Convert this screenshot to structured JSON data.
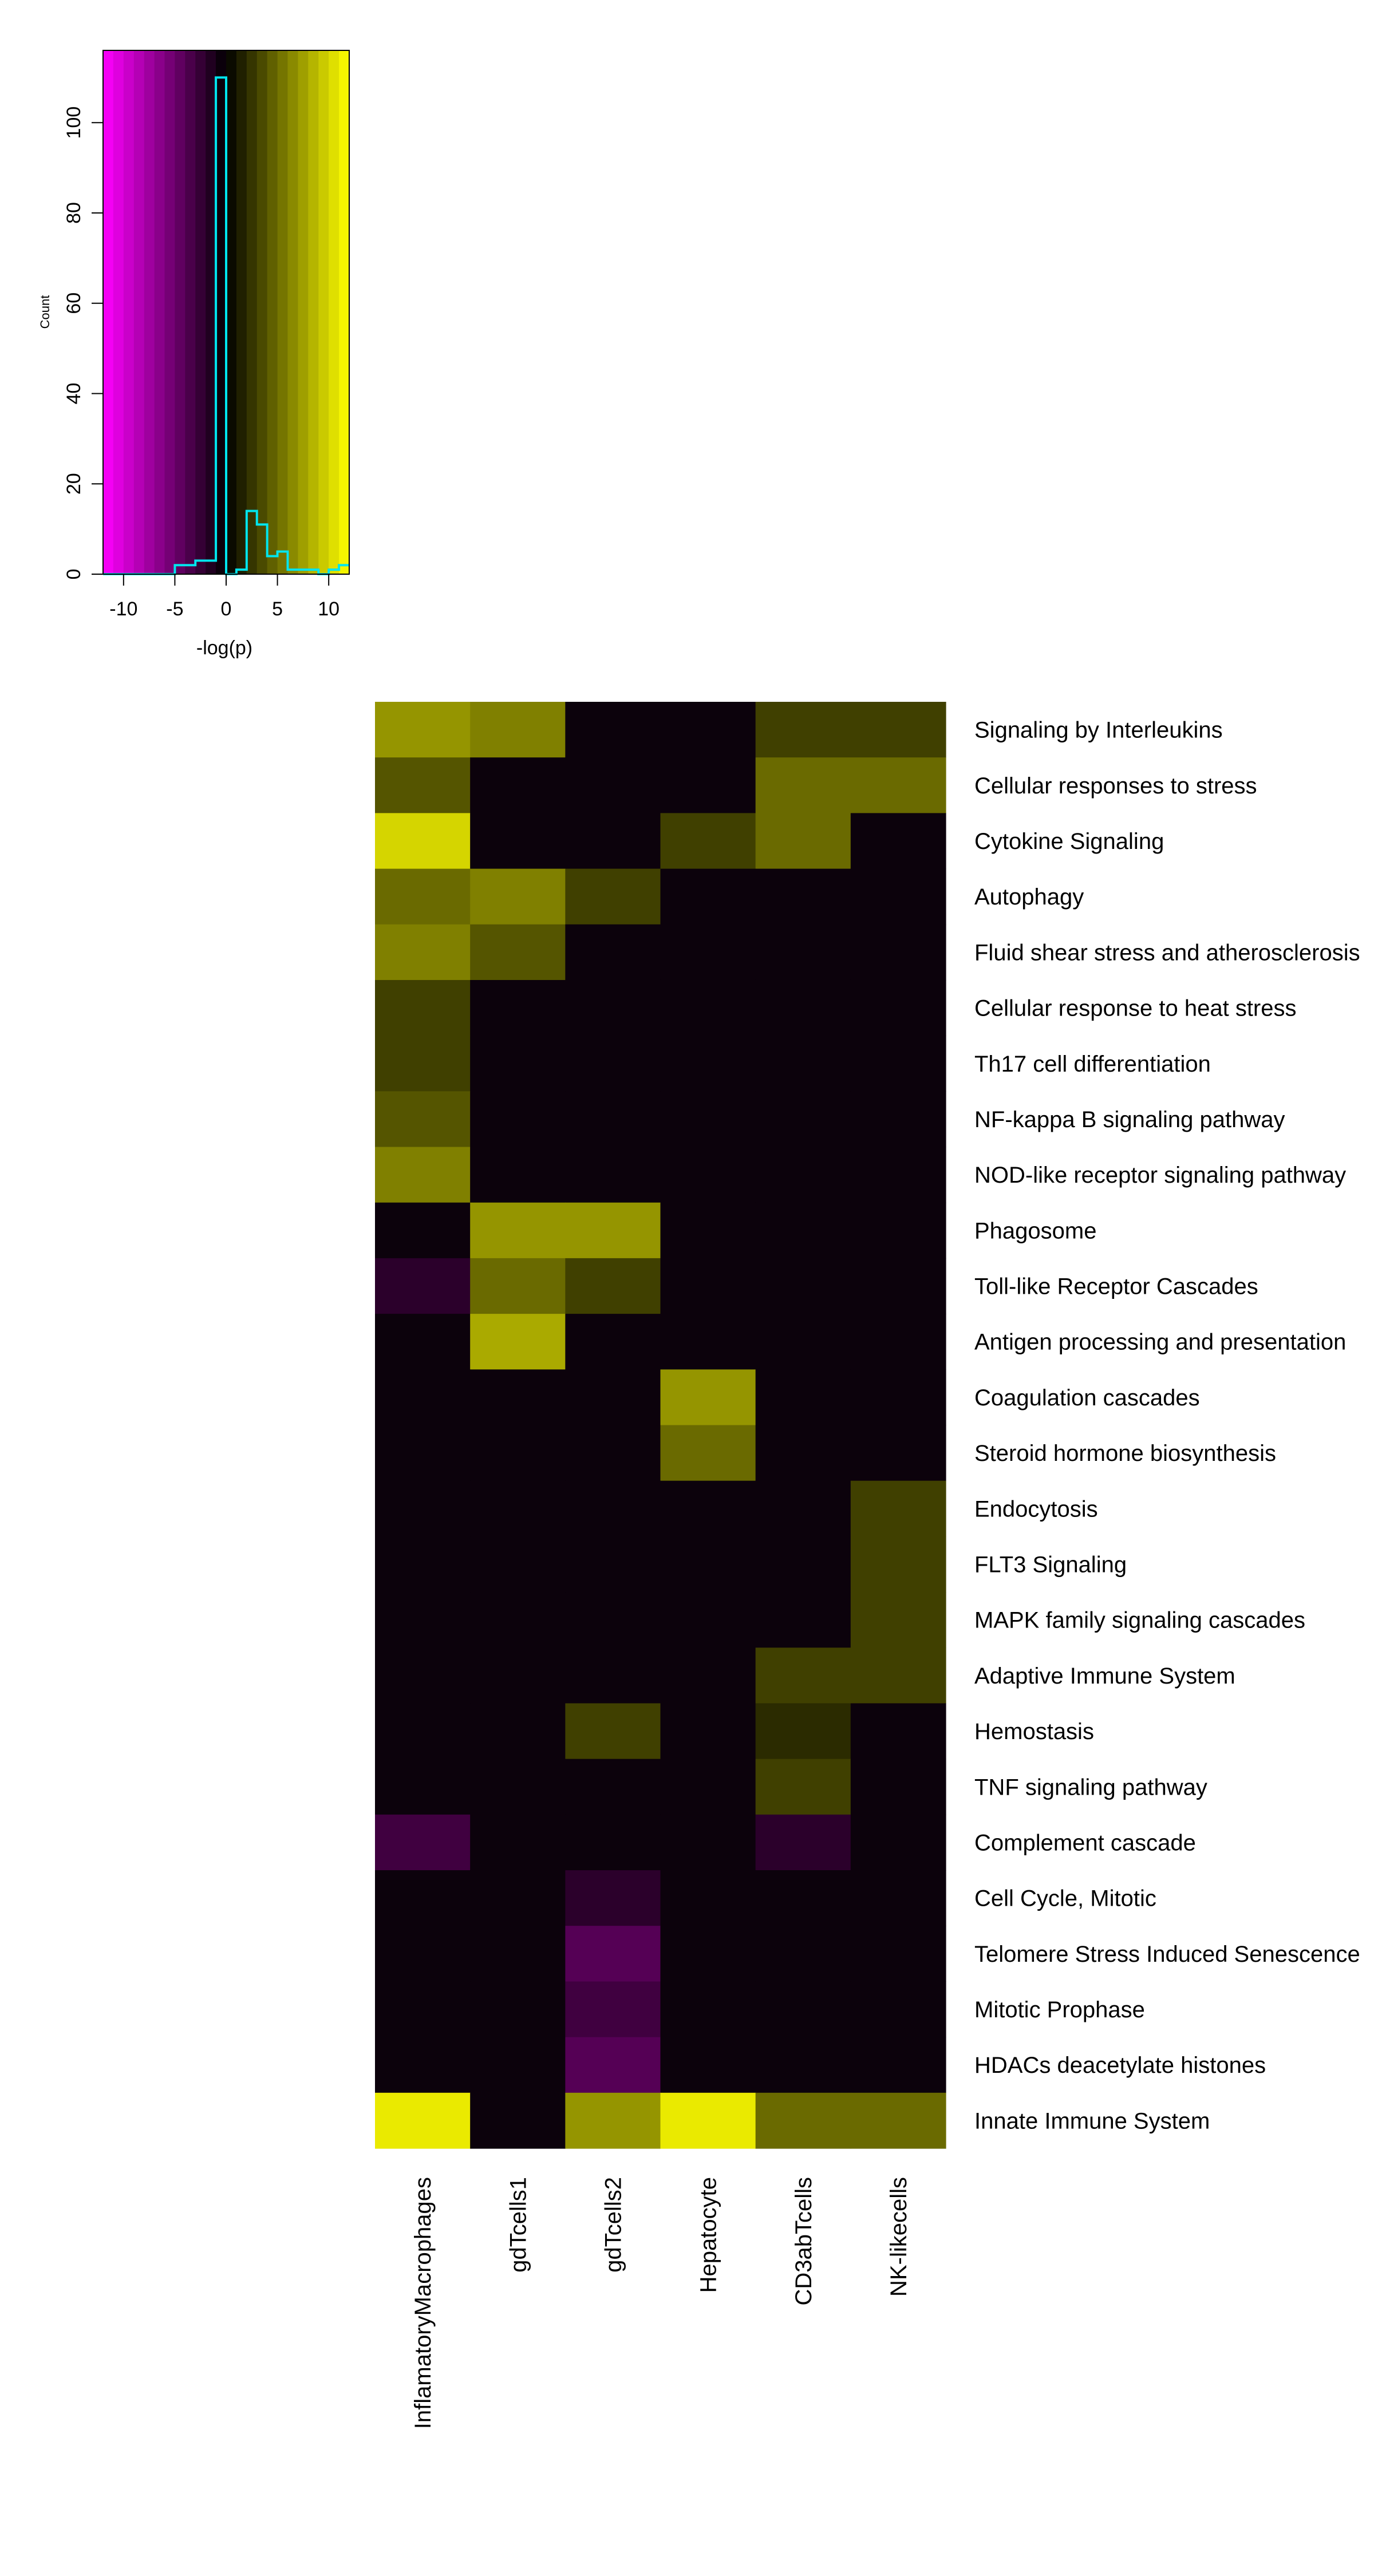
{
  "chart_data": [
    {
      "type": "histogram",
      "title": "",
      "xlabel": "-log(p)",
      "ylabel": "Count",
      "xlim": [
        -12,
        12
      ],
      "ylim": [
        0,
        116
      ],
      "x_ticks": [
        -10,
        -5,
        0,
        5,
        10
      ],
      "y_ticks": [
        0,
        20,
        40,
        60,
        80,
        100
      ],
      "grid": false,
      "color_scale": {
        "low": "#ff00ff",
        "mid": "#000000",
        "high": "#ffff00",
        "breaks": [
          -12,
          -11,
          -10,
          -9,
          -8,
          -7,
          -6,
          -5,
          -4,
          -3,
          -2,
          -1,
          0,
          1,
          2,
          3,
          4,
          5,
          6,
          7,
          8,
          9,
          10,
          11,
          12
        ]
      },
      "line_color": "#00e5ee",
      "bins": [
        {
          "x0": -12,
          "x1": -11,
          "count": 0
        },
        {
          "x0": -11,
          "x1": -10,
          "count": 0
        },
        {
          "x0": -10,
          "x1": -9,
          "count": 0
        },
        {
          "x0": -9,
          "x1": -8,
          "count": 0
        },
        {
          "x0": -8,
          "x1": -7,
          "count": 0
        },
        {
          "x0": -7,
          "x1": -6,
          "count": 0
        },
        {
          "x0": -6,
          "x1": -5,
          "count": 0
        },
        {
          "x0": -5,
          "x1": -4,
          "count": 2
        },
        {
          "x0": -4,
          "x1": -3,
          "count": 2
        },
        {
          "x0": -3,
          "x1": -2,
          "count": 3
        },
        {
          "x0": -2,
          "x1": -1,
          "count": 3
        },
        {
          "x0": -1,
          "x1": 0,
          "count": 110
        },
        {
          "x0": 0,
          "x1": 1,
          "count": 0
        },
        {
          "x0": 1,
          "x1": 2,
          "count": 1
        },
        {
          "x0": 2,
          "x1": 3,
          "count": 14
        },
        {
          "x0": 3,
          "x1": 4,
          "count": 11
        },
        {
          "x0": 4,
          "x1": 5,
          "count": 4
        },
        {
          "x0": 5,
          "x1": 6,
          "count": 5
        },
        {
          "x0": 6,
          "x1": 7,
          "count": 1
        },
        {
          "x0": 7,
          "x1": 8,
          "count": 1
        },
        {
          "x0": 8,
          "x1": 9,
          "count": 1
        },
        {
          "x0": 9,
          "x1": 10,
          "count": 0
        },
        {
          "x0": 10,
          "x1": 11,
          "count": 1
        },
        {
          "x0": 11,
          "x1": 12,
          "count": 2
        }
      ]
    },
    {
      "type": "heatmap",
      "title": "",
      "xlabel": "",
      "ylabel": "",
      "columns": [
        "InflamatoryMacrophages",
        "gdTcells1",
        "gdTcells2",
        "Hepatocyte",
        "CD3abTcells",
        "NK-likecells"
      ],
      "rows": [
        "Signaling by Interleukins",
        "Cellular responses to stress",
        "Cytokine Signaling",
        "Autophagy",
        "Fluid shear stress and atherosclerosis",
        "Cellular response to heat stress",
        "Th17 cell differentiation",
        "NF-kappa B signaling pathway",
        "NOD-like receptor signaling pathway",
        "Phagosome",
        "Toll-like Receptor Cascades",
        "Antigen processing and presentation",
        "Coagulation cascades",
        "Steroid hormone biosynthesis",
        "Endocytosis",
        "FLT3 Signaling",
        "MAPK family signaling cascades",
        "Adaptive Immune System",
        "Hemostasis",
        "TNF signaling pathway",
        "Complement cascade",
        "Cell Cycle, Mitotic",
        "Telomere Stress Induced Senescence",
        "Mitotic Prophase",
        "HDACs deacetylate histones",
        "Innate Immune System"
      ],
      "values": [
        [
          7,
          6,
          0,
          0,
          3,
          3
        ],
        [
          4,
          0,
          0,
          0,
          5,
          5
        ],
        [
          10,
          0,
          0,
          3,
          5,
          0
        ],
        [
          5,
          6,
          3,
          0,
          0,
          0
        ],
        [
          6,
          4,
          0,
          0,
          0,
          0
        ],
        [
          3,
          0,
          0,
          0,
          0,
          0
        ],
        [
          3,
          0,
          0,
          0,
          0,
          0
        ],
        [
          4,
          0,
          0,
          0,
          0,
          0
        ],
        [
          6,
          0,
          0,
          0,
          0,
          0
        ],
        [
          0,
          7,
          7,
          0,
          0,
          0
        ],
        [
          -2,
          5,
          3,
          0,
          0,
          0
        ],
        [
          0,
          8,
          0,
          0,
          0,
          0
        ],
        [
          0,
          0,
          0,
          7,
          0,
          0
        ],
        [
          0,
          0,
          0,
          5,
          0,
          0
        ],
        [
          0,
          0,
          0,
          0,
          0,
          3
        ],
        [
          0,
          0,
          0,
          0,
          0,
          3
        ],
        [
          0,
          0,
          0,
          0,
          0,
          3
        ],
        [
          0,
          0,
          0,
          0,
          3,
          3
        ],
        [
          0,
          0,
          3,
          0,
          2,
          0
        ],
        [
          0,
          0,
          0,
          0,
          3,
          0
        ],
        [
          -3,
          0,
          0,
          0,
          -2,
          0
        ],
        [
          0,
          0,
          -2,
          0,
          0,
          0
        ],
        [
          0,
          0,
          -4,
          0,
          0,
          0
        ],
        [
          0,
          0,
          -3,
          0,
          0,
          0
        ],
        [
          0,
          0,
          -4,
          0,
          0,
          0
        ],
        [
          11,
          0,
          7,
          11,
          5,
          5
        ]
      ]
    }
  ]
}
